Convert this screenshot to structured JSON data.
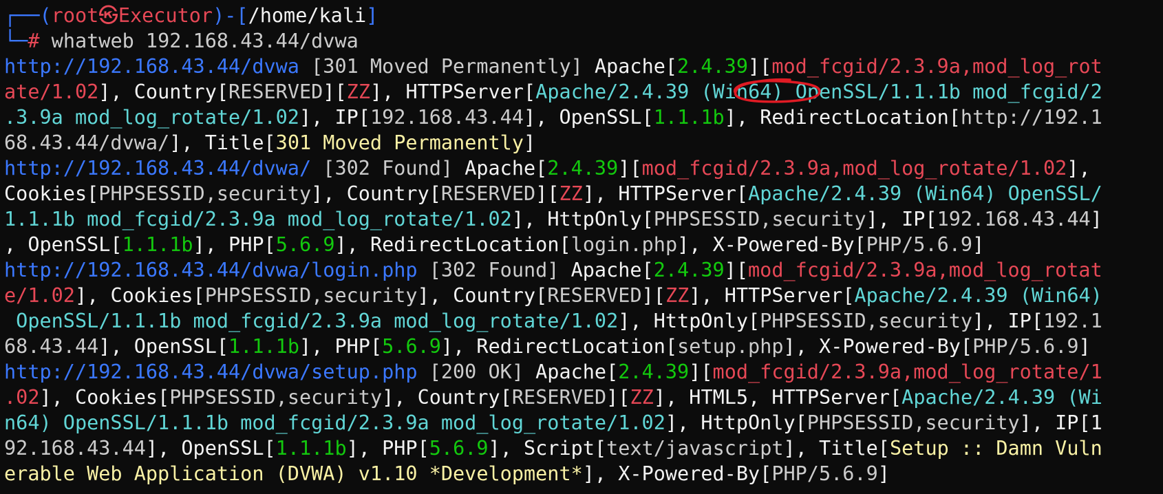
{
  "prompt": {
    "corner_top": "┌──",
    "open_paren": "(",
    "user": "root",
    "at": "㉿",
    "host": "Executor",
    "close_dash": ")-[",
    "path": "/home/kali",
    "close_bracket": "]",
    "corner_bottom": "└─",
    "hash": "#",
    "command": " whatweb 192.168.43.44/dvwa"
  },
  "colors": {
    "background": "#0c0c0c",
    "default_text": "#cccccc",
    "url": "#3b78ff",
    "version": "#13c90e",
    "module": "#e74856",
    "server": "#61d6d6",
    "title": "#f9f1a5",
    "annotation": "#e01b24"
  },
  "annotation": {
    "shape": "hand-drawn red ellipse",
    "target": "(Win64)"
  },
  "output": [
    [
      {
        "t": "http://192.168.43.44/dvwa",
        "c": "blu"
      },
      {
        "t": " [301 Moved Permanently] ",
        "c": "gry"
      },
      {
        "t": "Apache[",
        "c": "wht"
      },
      {
        "t": "2.4.39",
        "c": "grn"
      },
      {
        "t": "][",
        "c": "wht"
      },
      {
        "t": "mod_fcgid/2.3.9a,mod_log_rot",
        "c": "red"
      }
    ],
    [
      {
        "t": "ate/1.02",
        "c": "red"
      },
      {
        "t": "], ",
        "c": "wht"
      },
      {
        "t": "Country[",
        "c": "wht"
      },
      {
        "t": "RESERVED",
        "c": "gry"
      },
      {
        "t": "][",
        "c": "wht"
      },
      {
        "t": "ZZ",
        "c": "red"
      },
      {
        "t": "], ",
        "c": "wht"
      },
      {
        "t": "HTTPServer[",
        "c": "wht"
      },
      {
        "t": "Apache/2.4.39 (Win64) OpenSSL/1.1.1b mod_fcgid/2",
        "c": "cyn"
      }
    ],
    [
      {
        "t": ".3.9a mod_log_rotate/1.02",
        "c": "cyn"
      },
      {
        "t": "], ",
        "c": "wht"
      },
      {
        "t": "IP[",
        "c": "wht"
      },
      {
        "t": "192.168.43.44",
        "c": "gry"
      },
      {
        "t": "], ",
        "c": "wht"
      },
      {
        "t": "OpenSSL[",
        "c": "wht"
      },
      {
        "t": "1.1.1b",
        "c": "grn"
      },
      {
        "t": "], ",
        "c": "wht"
      },
      {
        "t": "RedirectLocation[",
        "c": "wht"
      },
      {
        "t": "http://192.1",
        "c": "gry"
      }
    ],
    [
      {
        "t": "68.43.44/dvwa/",
        "c": "gry"
      },
      {
        "t": "], ",
        "c": "wht"
      },
      {
        "t": "Title[",
        "c": "wht"
      },
      {
        "t": "301 Moved Permanently",
        "c": "yel"
      },
      {
        "t": "]",
        "c": "wht"
      }
    ],
    [
      {
        "t": "http://192.168.43.44/dvwa/",
        "c": "blu"
      },
      {
        "t": " [302 Found] ",
        "c": "gry"
      },
      {
        "t": "Apache[",
        "c": "wht"
      },
      {
        "t": "2.4.39",
        "c": "grn"
      },
      {
        "t": "][",
        "c": "wht"
      },
      {
        "t": "mod_fcgid/2.3.9a,mod_log_rotate/1.02",
        "c": "red"
      },
      {
        "t": "],",
        "c": "wht"
      }
    ],
    [
      {
        "t": "Cookies[",
        "c": "wht"
      },
      {
        "t": "PHPSESSID,security",
        "c": "gry"
      },
      {
        "t": "], ",
        "c": "wht"
      },
      {
        "t": "Country[",
        "c": "wht"
      },
      {
        "t": "RESERVED",
        "c": "gry"
      },
      {
        "t": "][",
        "c": "wht"
      },
      {
        "t": "ZZ",
        "c": "red"
      },
      {
        "t": "], ",
        "c": "wht"
      },
      {
        "t": "HTTPServer[",
        "c": "wht"
      },
      {
        "t": "Apache/2.4.39 (Win64) OpenSSL/",
        "c": "cyn"
      }
    ],
    [
      {
        "t": "1.1.1b mod_fcgid/2.3.9a mod_log_rotate/1.02",
        "c": "cyn"
      },
      {
        "t": "], ",
        "c": "wht"
      },
      {
        "t": "HttpOnly[",
        "c": "wht"
      },
      {
        "t": "PHPSESSID,security",
        "c": "gry"
      },
      {
        "t": "], ",
        "c": "wht"
      },
      {
        "t": "IP[",
        "c": "wht"
      },
      {
        "t": "192.168.43.44",
        "c": "gry"
      },
      {
        "t": "]",
        "c": "wht"
      }
    ],
    [
      {
        "t": ", ",
        "c": "wht"
      },
      {
        "t": "OpenSSL[",
        "c": "wht"
      },
      {
        "t": "1.1.1b",
        "c": "grn"
      },
      {
        "t": "], ",
        "c": "wht"
      },
      {
        "t": "PHP[",
        "c": "wht"
      },
      {
        "t": "5.6.9",
        "c": "grn"
      },
      {
        "t": "], ",
        "c": "wht"
      },
      {
        "t": "RedirectLocation[",
        "c": "wht"
      },
      {
        "t": "login.php",
        "c": "gry"
      },
      {
        "t": "], ",
        "c": "wht"
      },
      {
        "t": "X-Powered-By[",
        "c": "wht"
      },
      {
        "t": "PHP/5.6.9",
        "c": "gry"
      },
      {
        "t": "]",
        "c": "wht"
      }
    ],
    [
      {
        "t": "http://192.168.43.44/dvwa/login.php",
        "c": "blu"
      },
      {
        "t": " [302 Found] ",
        "c": "gry"
      },
      {
        "t": "Apache[",
        "c": "wht"
      },
      {
        "t": "2.4.39",
        "c": "grn"
      },
      {
        "t": "][",
        "c": "wht"
      },
      {
        "t": "mod_fcgid/2.3.9a,mod_log_rotat",
        "c": "red"
      }
    ],
    [
      {
        "t": "e/1.02",
        "c": "red"
      },
      {
        "t": "], ",
        "c": "wht"
      },
      {
        "t": "Cookies[",
        "c": "wht"
      },
      {
        "t": "PHPSESSID,security",
        "c": "gry"
      },
      {
        "t": "], ",
        "c": "wht"
      },
      {
        "t": "Country[",
        "c": "wht"
      },
      {
        "t": "RESERVED",
        "c": "gry"
      },
      {
        "t": "][",
        "c": "wht"
      },
      {
        "t": "ZZ",
        "c": "red"
      },
      {
        "t": "], ",
        "c": "wht"
      },
      {
        "t": "HTTPServer[",
        "c": "wht"
      },
      {
        "t": "Apache/2.4.39 (Win64)",
        "c": "cyn"
      }
    ],
    [
      {
        "t": " OpenSSL/1.1.1b mod_fcgid/2.3.9a mod_log_rotate/1.02",
        "c": "cyn"
      },
      {
        "t": "], ",
        "c": "wht"
      },
      {
        "t": "HttpOnly[",
        "c": "wht"
      },
      {
        "t": "PHPSESSID,security",
        "c": "gry"
      },
      {
        "t": "], ",
        "c": "wht"
      },
      {
        "t": "IP[",
        "c": "wht"
      },
      {
        "t": "192.1",
        "c": "gry"
      }
    ],
    [
      {
        "t": "68.43.44",
        "c": "gry"
      },
      {
        "t": "], ",
        "c": "wht"
      },
      {
        "t": "OpenSSL[",
        "c": "wht"
      },
      {
        "t": "1.1.1b",
        "c": "grn"
      },
      {
        "t": "], ",
        "c": "wht"
      },
      {
        "t": "PHP[",
        "c": "wht"
      },
      {
        "t": "5.6.9",
        "c": "grn"
      },
      {
        "t": "], ",
        "c": "wht"
      },
      {
        "t": "RedirectLocation[",
        "c": "wht"
      },
      {
        "t": "setup.php",
        "c": "gry"
      },
      {
        "t": "], ",
        "c": "wht"
      },
      {
        "t": "X-Powered-By[",
        "c": "wht"
      },
      {
        "t": "PHP/5.6.9",
        "c": "gry"
      },
      {
        "t": "]",
        "c": "wht"
      }
    ],
    [
      {
        "t": "http://192.168.43.44/dvwa/setup.php",
        "c": "blu"
      },
      {
        "t": " [200 OK] ",
        "c": "gry"
      },
      {
        "t": "Apache[",
        "c": "wht"
      },
      {
        "t": "2.4.39",
        "c": "grn"
      },
      {
        "t": "][",
        "c": "wht"
      },
      {
        "t": "mod_fcgid/2.3.9a,mod_log_rotate/1",
        "c": "red"
      }
    ],
    [
      {
        "t": ".02",
        "c": "red"
      },
      {
        "t": "], ",
        "c": "wht"
      },
      {
        "t": "Cookies[",
        "c": "wht"
      },
      {
        "t": "PHPSESSID,security",
        "c": "gry"
      },
      {
        "t": "], ",
        "c": "wht"
      },
      {
        "t": "Country[",
        "c": "wht"
      },
      {
        "t": "RESERVED",
        "c": "gry"
      },
      {
        "t": "][",
        "c": "wht"
      },
      {
        "t": "ZZ",
        "c": "red"
      },
      {
        "t": "], ",
        "c": "wht"
      },
      {
        "t": "HTML5, ",
        "c": "wht"
      },
      {
        "t": "HTTPServer[",
        "c": "wht"
      },
      {
        "t": "Apache/2.4.39 (Wi",
        "c": "cyn"
      }
    ],
    [
      {
        "t": "n64) OpenSSL/1.1.1b mod_fcgid/2.3.9a mod_log_rotate/1.02",
        "c": "cyn"
      },
      {
        "t": "], ",
        "c": "wht"
      },
      {
        "t": "HttpOnly[",
        "c": "wht"
      },
      {
        "t": "PHPSESSID,security",
        "c": "gry"
      },
      {
        "t": "], ",
        "c": "wht"
      },
      {
        "t": "IP[1",
        "c": "wht"
      }
    ],
    [
      {
        "t": "92.168.43.44",
        "c": "gry"
      },
      {
        "t": "], ",
        "c": "wht"
      },
      {
        "t": "OpenSSL[",
        "c": "wht"
      },
      {
        "t": "1.1.1b",
        "c": "grn"
      },
      {
        "t": "], ",
        "c": "wht"
      },
      {
        "t": "PHP[",
        "c": "wht"
      },
      {
        "t": "5.6.9",
        "c": "grn"
      },
      {
        "t": "], ",
        "c": "wht"
      },
      {
        "t": "Script[",
        "c": "wht"
      },
      {
        "t": "text/javascript",
        "c": "gry"
      },
      {
        "t": "], ",
        "c": "wht"
      },
      {
        "t": "Title[",
        "c": "wht"
      },
      {
        "t": "Setup :: Damn Vuln",
        "c": "yel"
      }
    ],
    [
      {
        "t": "erable Web Application (DVWA) v1.10 *Development*",
        "c": "yel"
      },
      {
        "t": "], ",
        "c": "wht"
      },
      {
        "t": "X-Powered-By[",
        "c": "wht"
      },
      {
        "t": "PHP/5.6.9",
        "c": "gry"
      },
      {
        "t": "]",
        "c": "wht"
      }
    ]
  ]
}
